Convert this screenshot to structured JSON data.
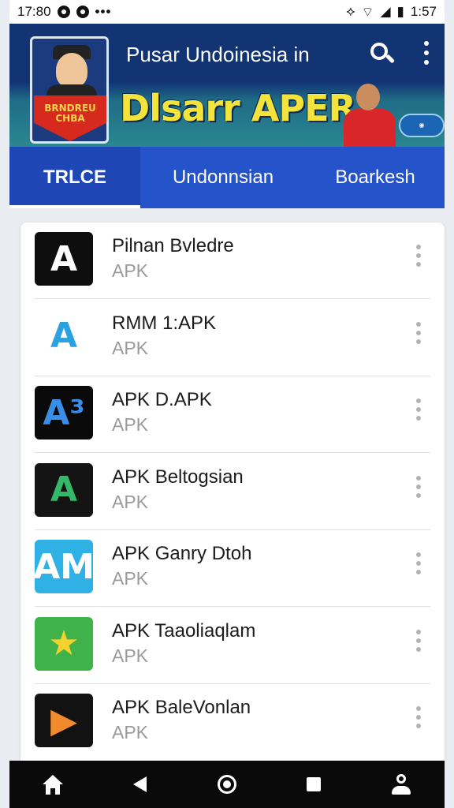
{
  "status_bar": {
    "time": "17:80",
    "clock_right": "1:57"
  },
  "header": {
    "title": "Pusar Undoinesia in",
    "banner_text": "Dlsarr APER",
    "logo_text": "BRNDREU CHBA"
  },
  "tabs": [
    {
      "label": "TRLCE",
      "active": true
    },
    {
      "label": "Undonnsian",
      "active": false
    },
    {
      "label": "Boarkesh",
      "active": false
    }
  ],
  "apps": [
    {
      "name": "Pilnan Bvledre",
      "type": "APK",
      "icon": "a-logo-black-icon",
      "icon_glyph": "A",
      "icon_bg": "#0e0e0e",
      "icon_fg": "#ffffff"
    },
    {
      "name": "RMM 1:APK",
      "type": "APK",
      "icon": "a-logo-blue-red-icon",
      "icon_glyph": "A",
      "icon_bg": "#ffffff",
      "icon_fg": "#2aa2e0"
    },
    {
      "name": "APK D.APK",
      "type": "APK",
      "icon": "ab-logo-icon",
      "icon_glyph": "A³",
      "icon_bg": "#0a0a0a",
      "icon_fg": "#3a8ee8"
    },
    {
      "name": "APK Beltogsian",
      "type": "APK",
      "icon": "a-logo-green-orange-icon",
      "icon_glyph": "A",
      "icon_bg": "#141414",
      "icon_fg": "#34b86a"
    },
    {
      "name": "APK Ganry Dtoh",
      "type": "APK",
      "icon": "am-logo-icon",
      "icon_glyph": "AM",
      "icon_bg": "#2fb1e6",
      "icon_fg": "#ffffff"
    },
    {
      "name": "APK Taaoliaqlam",
      "type": "APK",
      "icon": "star-logo-icon",
      "icon_glyph": "★",
      "icon_bg": "#3fb24a",
      "icon_fg": "#f3d12f"
    },
    {
      "name": "APK BaleVonlan",
      "type": "APK",
      "icon": "play-logo-icon",
      "icon_glyph": "▶",
      "icon_bg": "#121212",
      "icon_fg": "#f08a2a"
    }
  ],
  "nav": {
    "buttons": [
      "home-icon",
      "back-icon",
      "circle-icon",
      "square-icon",
      "person-icon"
    ]
  }
}
